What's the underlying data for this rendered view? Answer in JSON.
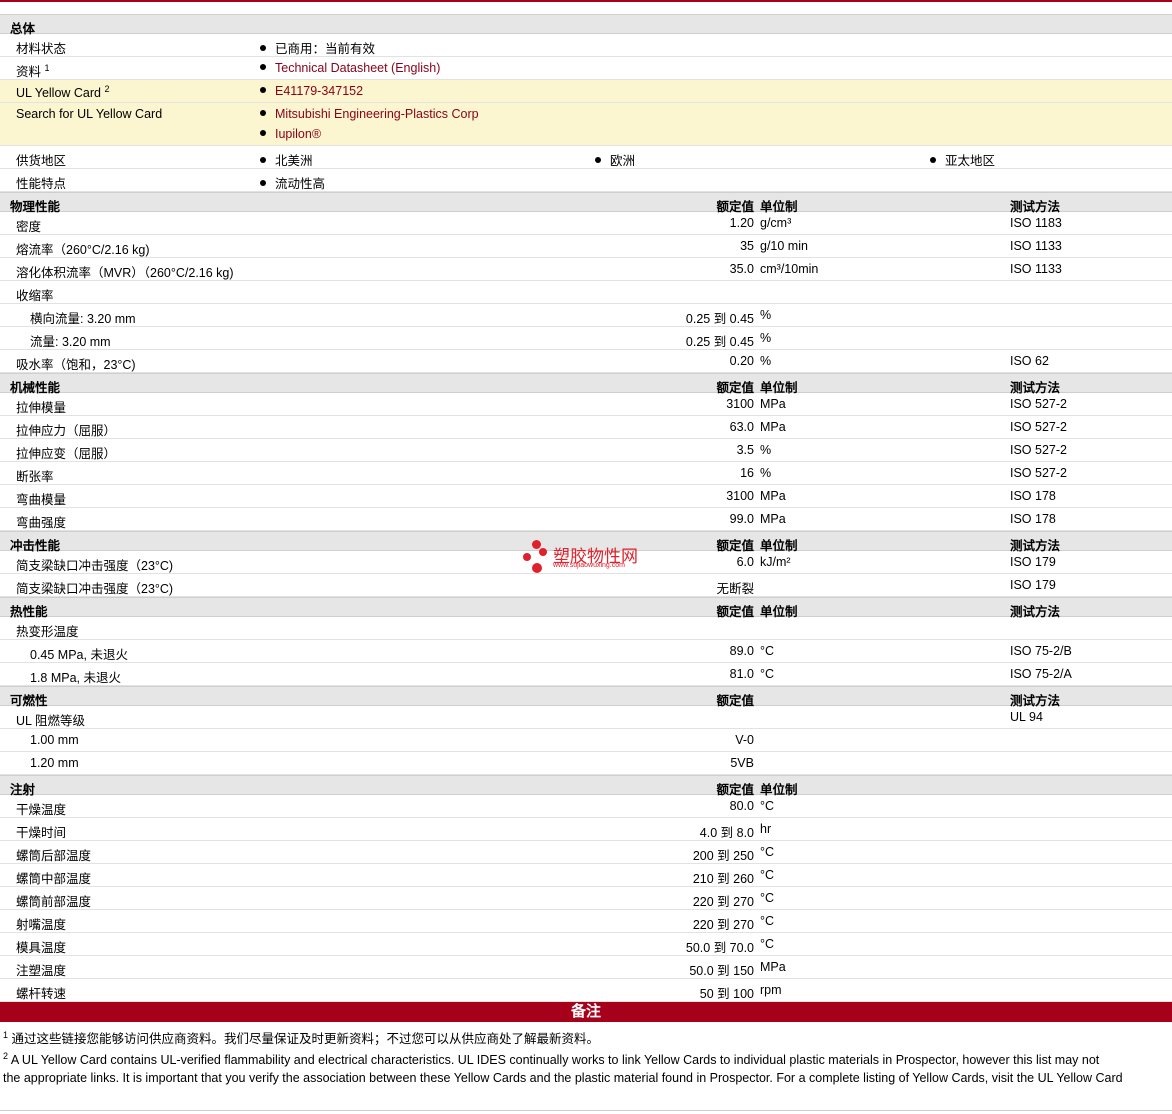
{
  "general": {
    "title": "总体",
    "status_label": "材料状态",
    "status_value": "已商用：当前有效",
    "docs_label": "资料",
    "docs_sup": "1",
    "docs_link": "Technical Datasheet (English)",
    "ulcard_label": "UL Yellow Card",
    "ulcard_sup": "2",
    "ulcard_link": "E41179-347152",
    "search_label": "Search for UL Yellow Card",
    "search_link1": "Mitsubishi Engineering-Plastics Corp",
    "search_link2": "Iupilon®",
    "supply_label": "供货地区",
    "supply_1": "北美洲",
    "supply_2": "欧洲",
    "supply_3": "亚太地区",
    "feature_label": "性能特点",
    "feature_value": "流动性高"
  },
  "headers": {
    "nominal": "额定值",
    "unit": "单位制",
    "test": "测试方法"
  },
  "physical": {
    "title": "物理性能",
    "rows": [
      {
        "label": "密度",
        "value": "1.20",
        "unit": "g/cm³",
        "test": "ISO 1183"
      },
      {
        "label": "熔流率（260°C/2.16 kg)",
        "value": "35",
        "unit": "g/10 min",
        "test": "ISO 1133"
      },
      {
        "label": "溶化体积流率（MVR）（260°C/2.16 kg)",
        "value": "35.0",
        "unit": "cm³/10min",
        "test": "ISO 1133"
      },
      {
        "label": "收缩率",
        "value": "",
        "unit": "",
        "test": ""
      },
      {
        "label": "横向流量: 3.20 mm",
        "value": "0.25 到  0.45",
        "unit": "%",
        "test": ""
      },
      {
        "label": "流量: 3.20 mm",
        "value": "0.25 到  0.45",
        "unit": "%",
        "test": ""
      },
      {
        "label": "吸水率（饱和，23°C)",
        "value": "0.20",
        "unit": "%",
        "test": "ISO 62"
      }
    ]
  },
  "mechanical": {
    "title": "机械性能",
    "rows": [
      {
        "label": "拉伸模量",
        "value": "3100",
        "unit": "MPa",
        "test": "ISO 527-2"
      },
      {
        "label": "拉伸应力（屈服）",
        "value": "63.0",
        "unit": "MPa",
        "test": "ISO 527-2"
      },
      {
        "label": "拉伸应变（屈服）",
        "value": "3.5",
        "unit": "%",
        "test": "ISO 527-2"
      },
      {
        "label": "断张率",
        "value": "16",
        "unit": "%",
        "test": "ISO 527-2"
      },
      {
        "label": "弯曲模量",
        "value": "3100",
        "unit": "MPa",
        "test": "ISO 178"
      },
      {
        "label": "弯曲强度",
        "value": "99.0",
        "unit": "MPa",
        "test": "ISO 178"
      }
    ]
  },
  "impact": {
    "title": "冲击性能",
    "rows": [
      {
        "label": "简支梁缺口冲击强度（23°C)",
        "value": "6.0",
        "unit": "kJ/m²",
        "test": "ISO 179"
      },
      {
        "label": "简支梁缺口冲击强度（23°C)",
        "value": "无断裂",
        "unit": "",
        "test": "ISO 179"
      }
    ]
  },
  "thermal": {
    "title": "热性能",
    "rows": [
      {
        "label": "热变形温度",
        "value": "",
        "unit": "",
        "test": ""
      },
      {
        "label": "0.45 MPa, 未退火",
        "value": "89.0",
        "unit": "°C",
        "test": "ISO 75-2/B"
      },
      {
        "label": "1.8 MPa, 未退火",
        "value": "81.0",
        "unit": "°C",
        "test": "ISO 75-2/A"
      }
    ]
  },
  "flammability": {
    "title": "可燃性",
    "rows": [
      {
        "label": "UL 阻燃等级",
        "value": "",
        "unit": "",
        "test": "UL 94"
      },
      {
        "label": "1.00 mm",
        "value": "V-0",
        "unit": "",
        "test": ""
      },
      {
        "label": "1.20 mm",
        "value": "5VB",
        "unit": "",
        "test": ""
      }
    ]
  },
  "injection": {
    "title": "注射",
    "rows": [
      {
        "label": "干燥温度",
        "value": "80.0",
        "unit": "°C",
        "test": ""
      },
      {
        "label": "干燥时间",
        "value": "4.0 到  8.0",
        "unit": "hr",
        "test": ""
      },
      {
        "label": "螺筒后部温度",
        "value": "200 到  250",
        "unit": "°C",
        "test": ""
      },
      {
        "label": "螺筒中部温度",
        "value": "210 到  260",
        "unit": "°C",
        "test": ""
      },
      {
        "label": "螺筒前部温度",
        "value": "220 到  270",
        "unit": "°C",
        "test": ""
      },
      {
        "label": "射嘴温度",
        "value": "220 到  270",
        "unit": "°C",
        "test": ""
      },
      {
        "label": "模具温度",
        "value": "50.0 到  70.0",
        "unit": "°C",
        "test": ""
      },
      {
        "label": "注塑温度",
        "value": "50.0 到  150",
        "unit": "MPa",
        "test": ""
      },
      {
        "label": "螺杆转速",
        "value": "50 到  100",
        "unit": "rpm",
        "test": ""
      }
    ]
  },
  "notes": {
    "title": "备注",
    "n1_sup": "1",
    "n1": "通过这些链接您能够访问供应商资料。我们尽量保证及时更新资料；不过您可以从供应商处了解最新资料。",
    "n2_sup": "2",
    "n2a": "A UL Yellow Card contains UL-verified flammability and electrical characteristics. UL IDES continually works to link Yellow Cards to individual plastic materials in Prospector, however this list may not",
    "n2b": "the appropriate links. It is important that you verify the association between these Yellow Cards and the plastic material found in Prospector. For a complete listing of Yellow Cards, visit the UL Yellow Card"
  },
  "watermark": {
    "text": "塑胶物性网",
    "sub": "www.sujiaowuxing.com"
  }
}
